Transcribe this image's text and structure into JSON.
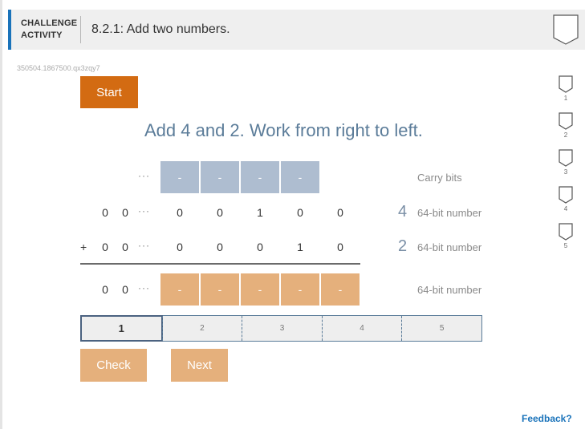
{
  "header": {
    "kind_line1": "CHALLENGE",
    "kind_line2": "ACTIVITY",
    "title": "8.2.1: Add two numbers."
  },
  "activity_id": "350504.1867500.qx3zqy7",
  "levels": [
    "1",
    "2",
    "3",
    "4",
    "5"
  ],
  "start_label": "Start",
  "instruction": "Add 4 and 2. Work from right to left.",
  "ellipsis": "···",
  "plus_sign": "+",
  "carry": {
    "cells": [
      "-",
      "-",
      "-",
      "-"
    ],
    "label": "Carry bits"
  },
  "number_a": {
    "leading": [
      "0",
      "0"
    ],
    "digits": [
      "0",
      "0",
      "1",
      "0",
      "0"
    ],
    "decimal": "4",
    "label": "64-bit number"
  },
  "number_b": {
    "leading": [
      "0",
      "0"
    ],
    "digits": [
      "0",
      "0",
      "0",
      "1",
      "0"
    ],
    "decimal": "2",
    "label": "64-bit number"
  },
  "result": {
    "leading": [
      "0",
      "0"
    ],
    "cells": [
      "-",
      "-",
      "-",
      "-",
      "-"
    ],
    "label": "64-bit number"
  },
  "steps": [
    "1",
    "2",
    "3",
    "4",
    "5"
  ],
  "check_label": "Check",
  "next_label": "Next",
  "feedback_label": "Feedback?",
  "colors": {
    "accent": "#1a73ba",
    "start": "#d36b12",
    "result_cell": "#e5b07c",
    "carry_cell": "#aebdd0",
    "instruction": "#5b7c99"
  }
}
